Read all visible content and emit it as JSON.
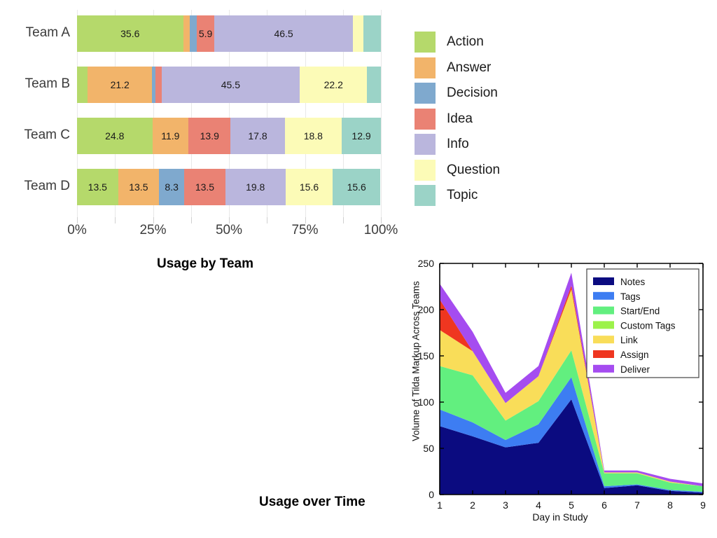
{
  "titles": {
    "top_chart": "Usage by Team",
    "bottom_chart": "Usage over Time"
  },
  "chart_data": [
    {
      "id": "usage-by-team",
      "type": "bar",
      "orientation": "horizontal",
      "stacked": true,
      "normalized": true,
      "title": "Usage by Team",
      "xlabel": "",
      "ylabel": "",
      "xlim": [
        0,
        100
      ],
      "grid": true,
      "legend_position": "right",
      "xtick_labels": [
        "0%",
        "25%",
        "50%",
        "75%",
        "100%"
      ],
      "xtick_values": [
        0,
        25,
        50,
        75,
        100
      ],
      "categories": [
        "Team A",
        "Team B",
        "Team C",
        "Team D"
      ],
      "series": [
        {
          "name": "Action",
          "color": "#b5d96b",
          "values": [
            35.6,
            3.5,
            24.8,
            13.5
          ]
        },
        {
          "name": "Answer",
          "color": "#f2b46a",
          "values": [
            2.3,
            21.2,
            11.9,
            13.5
          ]
        },
        {
          "name": "Decision",
          "color": "#7fa9ce",
          "values": [
            2.3,
            1.2,
            0.0,
            8.3
          ]
        },
        {
          "name": "Idea",
          "color": "#ea8274",
          "values": [
            5.9,
            1.9,
            13.9,
            13.5
          ]
        },
        {
          "name": "Info",
          "color": "#bab6dd",
          "values": [
            46.5,
            45.5,
            17.8,
            19.8
          ]
        },
        {
          "name": "Question",
          "color": "#fcfbb7",
          "values": [
            3.6,
            22.2,
            18.8,
            15.6
          ]
        },
        {
          "name": "Topic",
          "color": "#9bd3c7",
          "values": [
            5.8,
            4.5,
            12.9,
            15.6
          ]
        }
      ],
      "visible_labels": {
        "Team A": {
          "Action": "35.6",
          "Idea": "5.9",
          "Info": "46.5"
        },
        "Team B": {
          "Answer": "21.2",
          "Info": "45.5",
          "Question": "22.2"
        },
        "Team C": {
          "Action": "24.8",
          "Answer": "11.9",
          "Idea": "13.9",
          "Info": "17.8",
          "Question": "18.8",
          "Topic": "12.9"
        },
        "Team D": {
          "Action": "13.5",
          "Answer": "13.5",
          "Decision": "8.3",
          "Idea": "13.5",
          "Info": "19.8",
          "Question": "15.6",
          "Topic": "15.6"
        }
      }
    },
    {
      "id": "usage-over-time",
      "type": "area",
      "stacked": true,
      "title": "Usage over Time",
      "xlabel": "Day in Study",
      "ylabel": "Volume of Tilda Markup Across Teams",
      "x": [
        1,
        2,
        3,
        4,
        5,
        6,
        7,
        8,
        9
      ],
      "xtick_labels": [
        "1",
        "2",
        "3",
        "4",
        "5",
        "6",
        "7",
        "8",
        "9"
      ],
      "ytick_labels": [
        "0",
        "50",
        "100",
        "150",
        "200",
        "250"
      ],
      "ytick_values": [
        0,
        50,
        100,
        150,
        200,
        250
      ],
      "xlim": [
        1,
        9
      ],
      "ylim": [
        0,
        250
      ],
      "grid": false,
      "legend_position": "upper right",
      "series": [
        {
          "name": "Notes",
          "color": "#0b0b80",
          "values": [
            74,
            63,
            51,
            56,
            103,
            7,
            10,
            4,
            2
          ]
        },
        {
          "name": "Tags",
          "color": "#3d7df2",
          "values": [
            18,
            15,
            8,
            20,
            24,
            2,
            1,
            1,
            1
          ]
        },
        {
          "name": "Start/End",
          "color": "#62ef7f",
          "values": [
            47,
            51,
            21,
            25,
            29,
            14,
            12,
            8,
            6
          ]
        },
        {
          "name": "Custom Tags",
          "color": "#9cf24a",
          "values": [
            0,
            0,
            0,
            0,
            0,
            0,
            0,
            0,
            0
          ]
        },
        {
          "name": "Link",
          "color": "#f9dd59",
          "values": [
            39,
            26,
            19,
            27,
            66,
            1,
            1,
            1,
            0
          ]
        },
        {
          "name": "Assign",
          "color": "#ef3620",
          "values": [
            33,
            0,
            0,
            0,
            4,
            0,
            0,
            0,
            0
          ]
        },
        {
          "name": "Deliver",
          "color": "#a54cf0",
          "values": [
            17,
            21,
            11,
            11,
            14,
            2,
            2,
            3,
            3
          ]
        }
      ]
    }
  ]
}
